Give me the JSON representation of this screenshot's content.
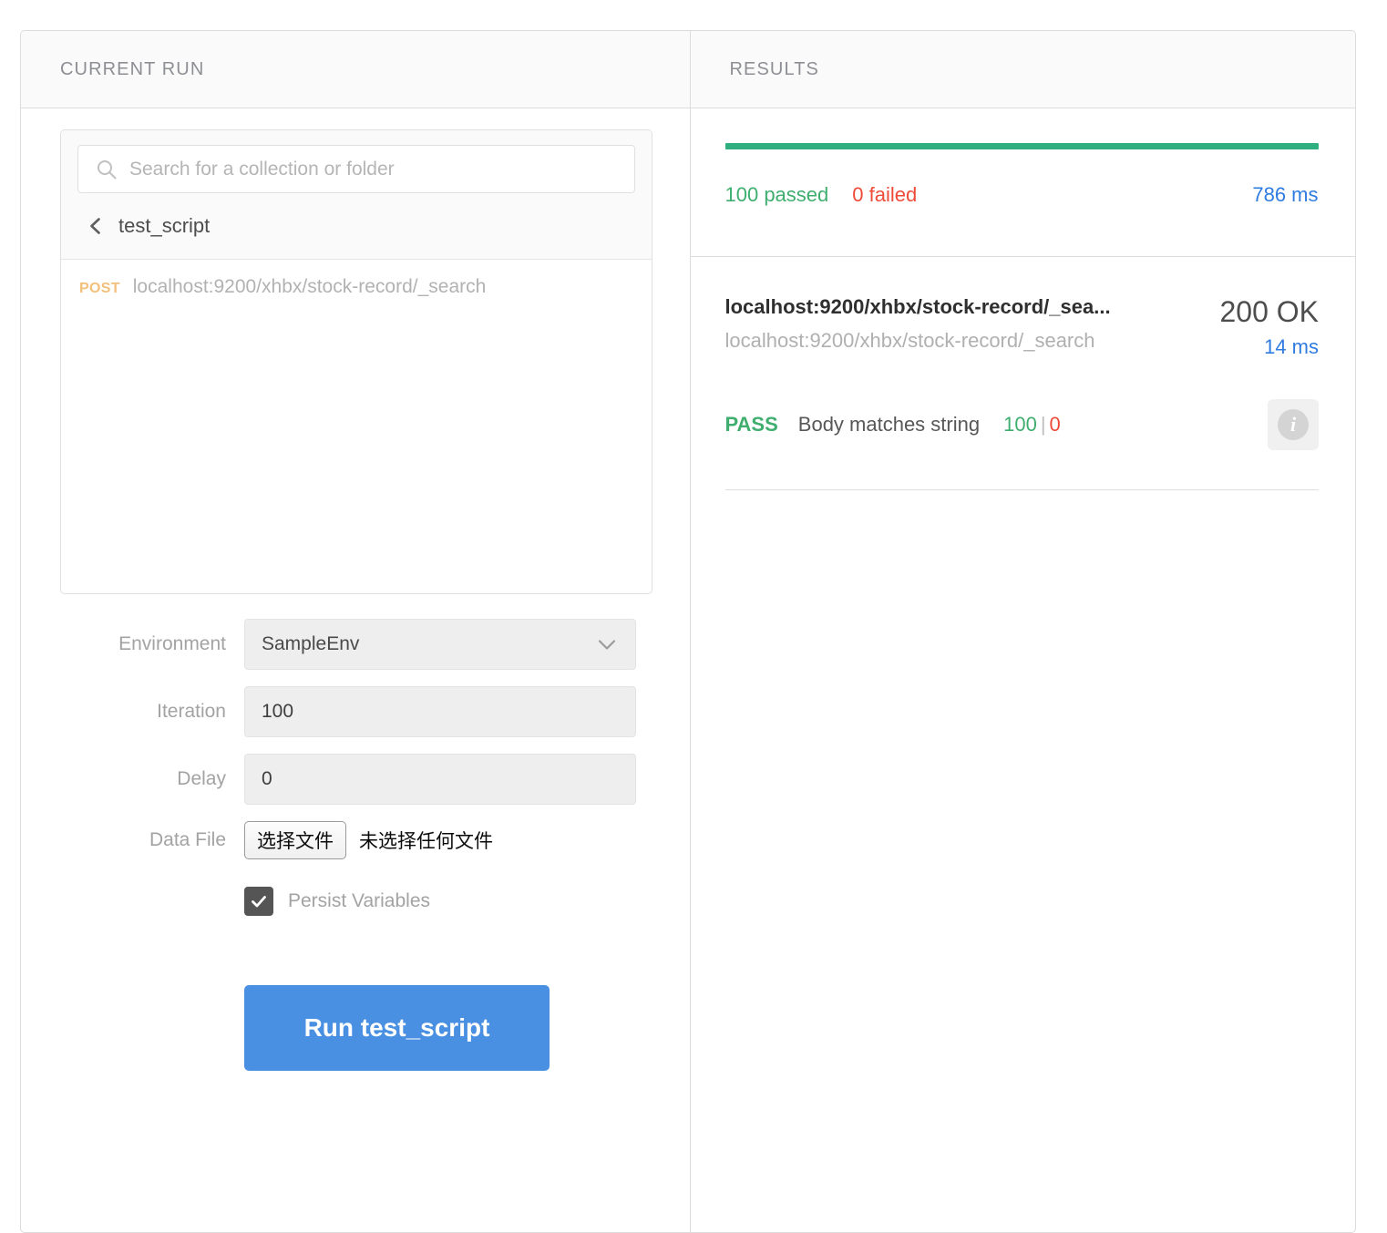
{
  "left_panel": {
    "header_title": "CURRENT RUN",
    "picker": {
      "search_placeholder": "Search for a collection or folder",
      "search_value": "",
      "search_icon": "search-icon",
      "back_icon": "chevron-left-icon",
      "breadcrumb_label": "test_script",
      "requests": [
        {
          "method": "POST",
          "url": "localhost:9200/xhbx/stock-record/_search"
        }
      ]
    },
    "form": {
      "environment_label": "Environment",
      "environment_value": "SampleEnv",
      "environment_dropdown_icon": "chevron-down-icon",
      "iteration_label": "Iteration",
      "iteration_value": "100",
      "delay_label": "Delay",
      "delay_value": "0",
      "data_file_label": "Data File",
      "data_file_button": "选择文件",
      "data_file_status": "未选择任何文件",
      "persist_label": "Persist Variables",
      "persist_checked": "true",
      "check_icon": "check-icon",
      "run_button_label": "Run test_script"
    }
  },
  "right_panel": {
    "header_title": "RESULTS",
    "summary": {
      "passed": "100 passed",
      "failed": "0 failed",
      "total_time": "786 ms",
      "progress_percent": "100"
    },
    "results": [
      {
        "title": "localhost:9200/xhbx/stock-record/_sea...",
        "subtitle": "localhost:9200/xhbx/stock-record/_search",
        "status_code": "200 OK",
        "time": "14 ms",
        "assertion": {
          "verdict": "PASS",
          "name": "Body matches string",
          "pass_count": "100",
          "separator": "|",
          "fail_count": "0",
          "info_icon": "info-icon"
        }
      }
    ]
  },
  "colors": {
    "accent_blue": "#4a90e2",
    "pass_green": "#3fae6e",
    "bar_green": "#2fae80",
    "fail_red": "#ee4b39",
    "time_blue": "#2f7ce0",
    "method_post": "#f3c07b"
  }
}
